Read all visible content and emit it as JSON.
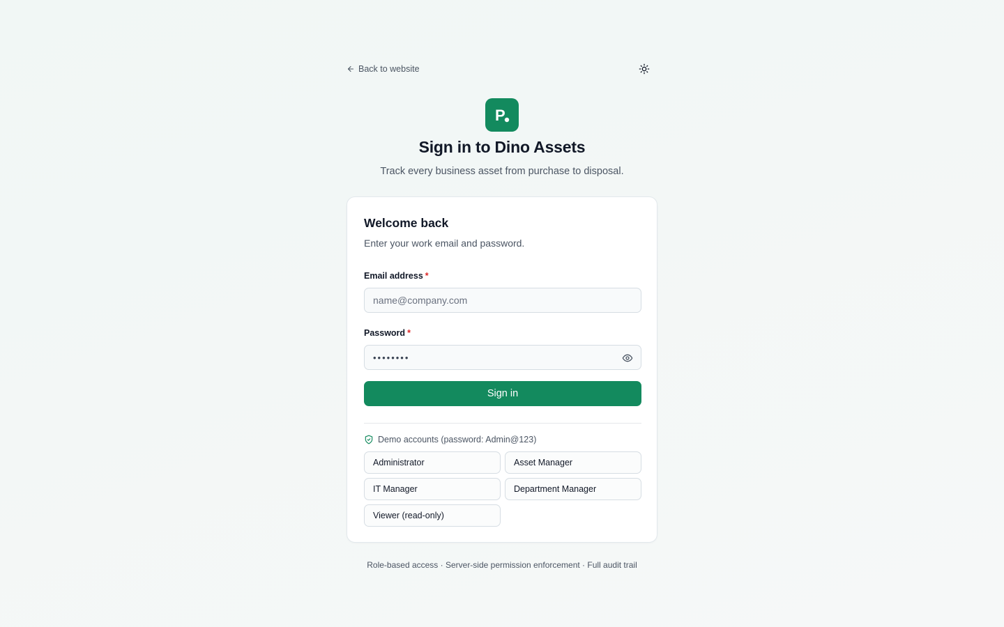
{
  "colors": {
    "brand": "#138a5e",
    "required": "#dc2626"
  },
  "nav": {
    "back_label": "Back to website",
    "back_icon": "arrow-left-icon",
    "theme_icon": "sun-icon"
  },
  "brand": {
    "logo_letter": "P"
  },
  "header": {
    "title": "Sign in to Dino Assets",
    "subtitle": "Track every business asset from purchase to disposal."
  },
  "card": {
    "title": "Welcome back",
    "subtitle": "Enter your work email and password."
  },
  "form": {
    "email": {
      "label": "Email address",
      "required_mark": "*",
      "value": "",
      "placeholder": "name@company.com"
    },
    "password": {
      "label": "Password",
      "required_mark": "*",
      "masked_value": "••••••••",
      "toggle_icon": "eye-icon"
    },
    "submit_label": "Sign in"
  },
  "demo": {
    "note": "Demo accounts (password: Admin@123)",
    "icon": "shield-check-icon",
    "accounts": [
      {
        "label": "Administrator"
      },
      {
        "label": "Asset Manager"
      },
      {
        "label": "IT Manager"
      },
      {
        "label": "Department Manager"
      },
      {
        "label": "Viewer (read-only)"
      }
    ]
  },
  "footer": {
    "text": "Role-based access · Server-side permission enforcement · Full audit trail"
  }
}
